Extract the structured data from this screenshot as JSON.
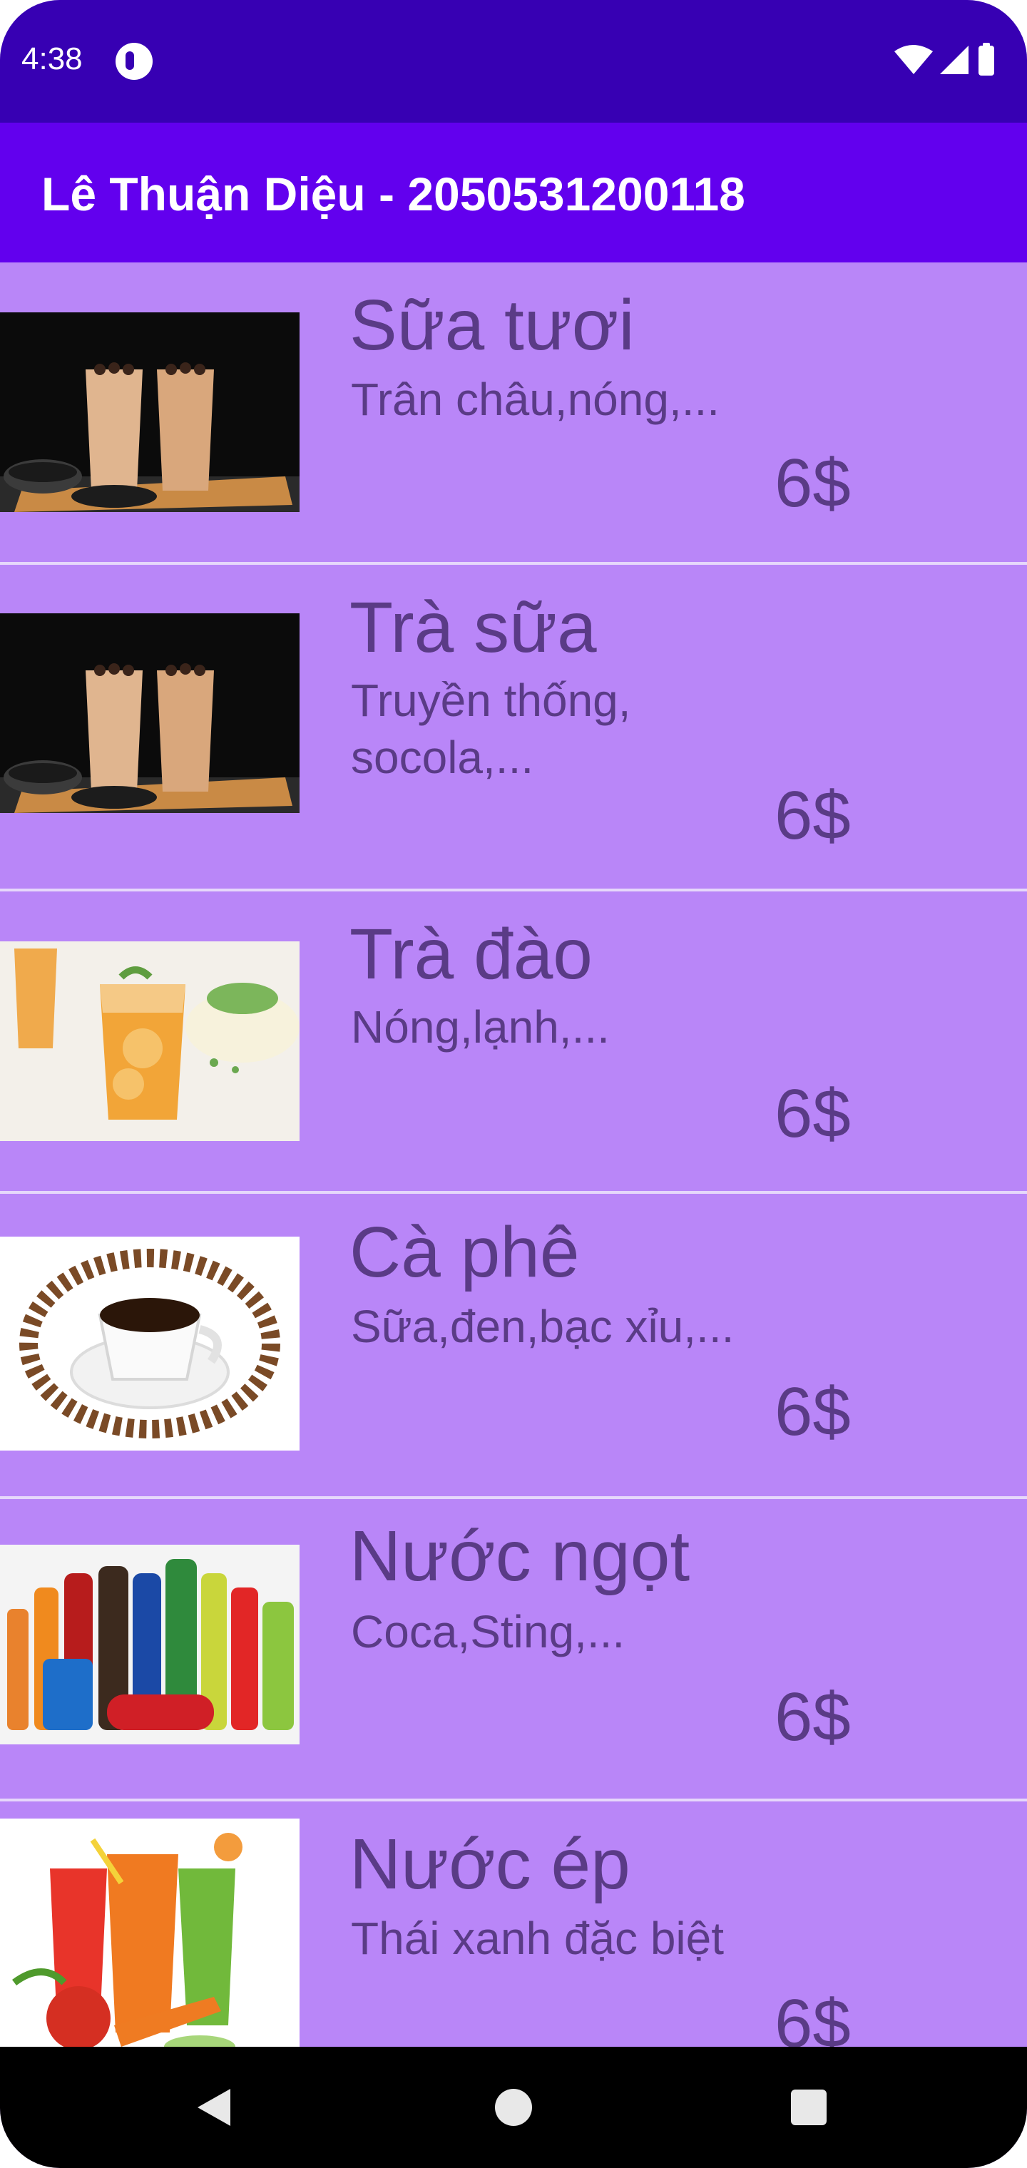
{
  "status_bar": {
    "time": "4:38",
    "icons": [
      "notification-icon",
      "wifi-icon",
      "signal-icon",
      "battery-icon"
    ]
  },
  "app_bar": {
    "title": "Lê Thuận Diệu - 2050531200118"
  },
  "colors": {
    "status_bar": "#3700b3",
    "app_bar": "#6200ee",
    "list_background": "#b986f8",
    "text": "#5a3b86"
  },
  "items": [
    {
      "name": "Sữa tươi",
      "description": "Trân châu,nóng,...",
      "price": "6$",
      "image": "bubble-milk-tea-image"
    },
    {
      "name": "Trà sữa",
      "description": "Truyền thống, socola,...",
      "price": "6$",
      "image": "bubble-milk-tea-image"
    },
    {
      "name": "Trà đào",
      "description": "Nóng,lạnh,...",
      "price": "6$",
      "image": "peach-tea-image"
    },
    {
      "name": "Cà phê",
      "description": "Sữa,đen,bạc xỉu,...",
      "price": "6$",
      "image": "coffee-cup-image"
    },
    {
      "name": "Nước ngọt",
      "description": "Coca,Sting,...",
      "price": "6$",
      "image": "soft-drinks-image"
    },
    {
      "name": "Nước ép",
      "description": "Thái xanh đặc biệt",
      "price": "6$",
      "image": "fruit-juice-image"
    }
  ],
  "nav_bar": {
    "buttons": [
      "back-icon",
      "home-icon",
      "recents-icon"
    ]
  }
}
